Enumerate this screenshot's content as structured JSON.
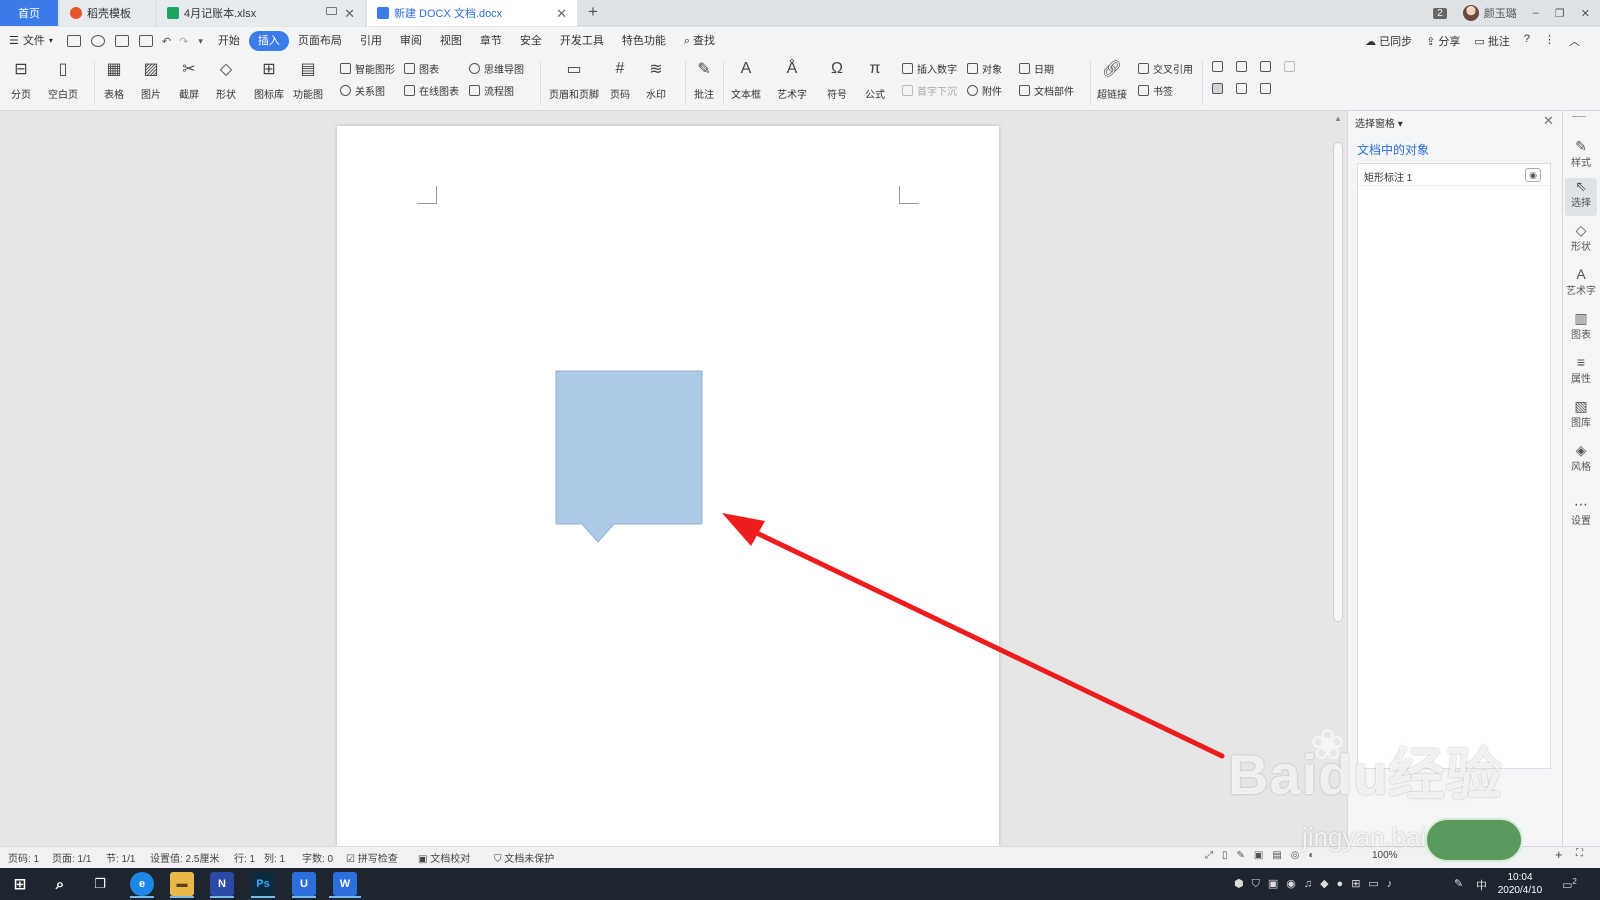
{
  "tabs": {
    "home": "首页",
    "t1": "稻壳模板",
    "t2": "4月记账本.xlsx",
    "t3": "新建 DOCX 文档.docx",
    "new": "+"
  },
  "window": {
    "badge": "2",
    "user": "颜玉璐",
    "minimize": "–",
    "restore": "❐",
    "close": "✕"
  },
  "menu": {
    "file": "文件",
    "items": [
      "开始",
      "插入",
      "页面布局",
      "引用",
      "审阅",
      "视图",
      "章节",
      "安全",
      "开发工具",
      "特色功能"
    ],
    "active": "插入",
    "search": "查找",
    "sync": "已同步",
    "share": "分享",
    "comment": "批注",
    "help": "?",
    "more": "⋮",
    "collapse": "︿"
  },
  "ribbon": {
    "page_break": "分页",
    "blank_page": "空白页",
    "table": "表格",
    "picture": "图片",
    "screenshot": "截屏",
    "shape": "形状",
    "icon_lib": "图标库",
    "function_chart": "功能图",
    "smart_art": "智能图形",
    "relation": "关系图",
    "chart": "图表",
    "online_chart": "在线图表",
    "mind_map": "思维导图",
    "flowchart": "流程图",
    "header_footer": "页眉和页脚",
    "page_number": "页码",
    "watermark": "水印",
    "comment": "批注",
    "textbox": "文本框",
    "wordart": "艺术字",
    "symbol": "符号",
    "formula": "公式",
    "insert_number": "插入数字",
    "first_letter": "首字下沉",
    "object": "对象",
    "attachment": "附件",
    "date": "日期",
    "doc_parts": "文档部件",
    "hyperlink": "超链接",
    "cross_ref": "交叉引用",
    "bookmark": "书签"
  },
  "selection_pane": {
    "title": "选择窗格",
    "section": "文档中的对象",
    "objects": [
      "矩形标注 1"
    ]
  },
  "right_bar": [
    "样式",
    "选择",
    "形状",
    "艺术字",
    "图表",
    "属性",
    "图库",
    "风格",
    "设置"
  ],
  "shape": {
    "fill": "#adc9e6",
    "stroke": "#8fb1d6"
  },
  "arrow": {
    "color": "#ee1c1c"
  },
  "status": {
    "page_code": "页码: 1",
    "pages": "页面: 1/1",
    "section": "节: 1/1",
    "setting": "设置值: 2.5厘米",
    "row": "行: 1",
    "col": "列: 1",
    "words": "字数: 0",
    "spell": "拼写检查",
    "proof": "文档校对",
    "protect": "文档未保护",
    "zoom": "100%"
  },
  "taskbar": {
    "time": "10:04",
    "date": "2020/4/10",
    "ime": "中",
    "notif": "2"
  },
  "watermark": {
    "brand": "Baidu经验",
    "url": "jingyan.baidu.com"
  }
}
